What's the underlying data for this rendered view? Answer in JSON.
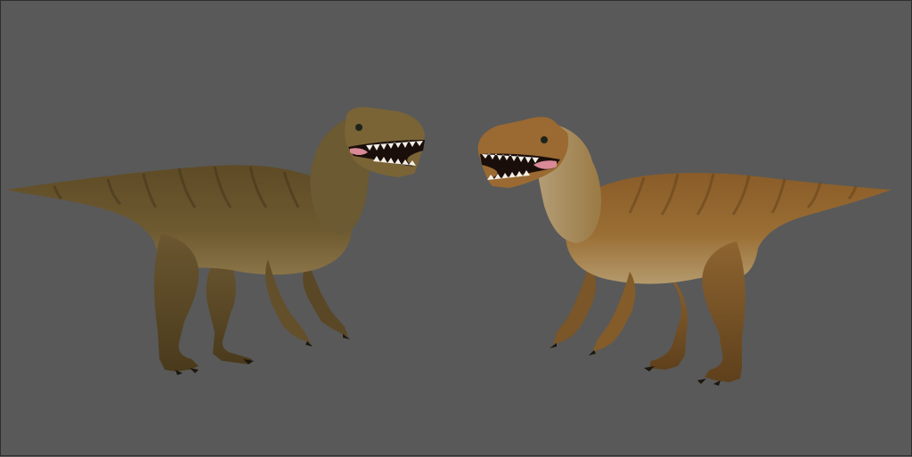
{
  "viewport": {
    "background_color": "#595959",
    "border_color": "#2e2e2e"
  },
  "models": [
    {
      "id": "left",
      "facing": "right",
      "primary_color": "#6e5a30",
      "belly_color": "#8f7a4c",
      "stripe_color": "#3e3018",
      "claw_color": "#1c160c"
    },
    {
      "id": "right",
      "facing": "left",
      "primary_color": "#9a6e34",
      "belly_color": "#b8a27a",
      "stripe_color": "#5c3c18",
      "claw_color": "#1c160c"
    }
  ],
  "mouth_color": "#1a0e0a",
  "tongue_color": "#d88a96",
  "teeth_color": "#f2efe6",
  "eye_color": "#1e2418"
}
